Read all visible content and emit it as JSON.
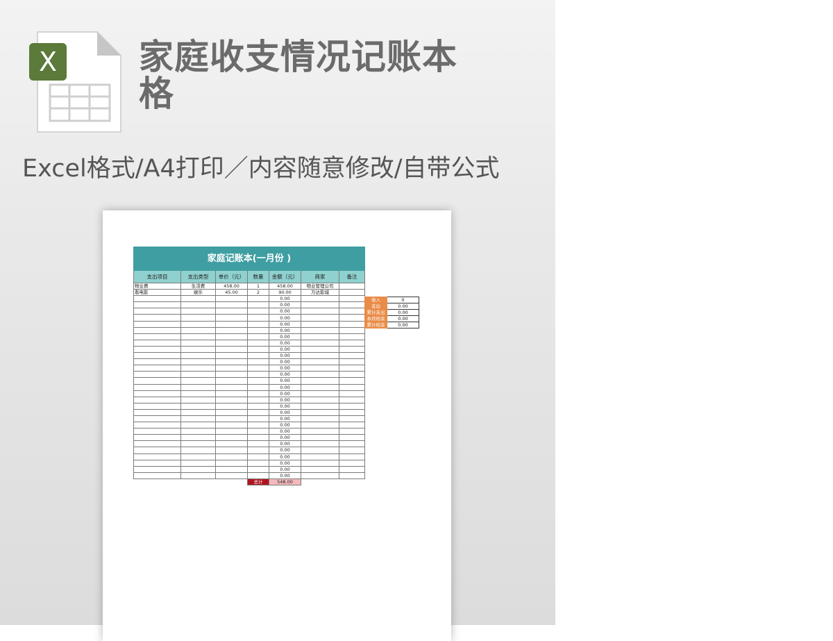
{
  "header": {
    "title": "家庭收支情况记账本格",
    "subtitle": "Excel格式/A4打印／内容随意修改/自带公式"
  },
  "icon": {
    "name": "excel-file-icon",
    "badge_glyph": "X",
    "badge_color": "#5c7a3a",
    "body_color": "#ffffff",
    "fold_color": "#c6c6c6"
  },
  "ledger": {
    "title": "家庭记账本(一月份 )",
    "columns": [
      "支出项目",
      "支出类型",
      "单价（元）",
      "数量",
      "金额（元）",
      "商家",
      "备注"
    ],
    "rows": [
      [
        "物业费",
        "生活费",
        "458.00",
        "1",
        "458.00",
        "物业管理公司",
        ""
      ],
      [
        "看电影",
        "娱乐",
        "45.00",
        "2",
        "90.00",
        "万达影城",
        ""
      ],
      [
        "",
        "",
        "",
        "",
        "0.00",
        "",
        ""
      ],
      [
        "",
        "",
        "",
        "",
        "0.00",
        "",
        ""
      ],
      [
        "",
        "",
        "",
        "",
        "0.00",
        "",
        ""
      ],
      [
        "",
        "",
        "",
        "",
        "0.00",
        "",
        ""
      ],
      [
        "",
        "",
        "",
        "",
        "0.00",
        "",
        ""
      ],
      [
        "",
        "",
        "",
        "",
        "0.00",
        "",
        ""
      ],
      [
        "",
        "",
        "",
        "",
        "0.00",
        "",
        ""
      ],
      [
        "",
        "",
        "",
        "",
        "0.00",
        "",
        ""
      ],
      [
        "",
        "",
        "",
        "",
        "0.00",
        "",
        ""
      ],
      [
        "",
        "",
        "",
        "",
        "0.00",
        "",
        ""
      ],
      [
        "",
        "",
        "",
        "",
        "0.00",
        "",
        ""
      ],
      [
        "",
        "",
        "",
        "",
        "0.00",
        "",
        ""
      ],
      [
        "",
        "",
        "",
        "",
        "0.00",
        "",
        ""
      ],
      [
        "",
        "",
        "",
        "",
        "0.00",
        "",
        ""
      ],
      [
        "",
        "",
        "",
        "",
        "0.00",
        "",
        ""
      ],
      [
        "",
        "",
        "",
        "",
        "0.00",
        "",
        ""
      ],
      [
        "",
        "",
        "",
        "",
        "0.00",
        "",
        ""
      ],
      [
        "",
        "",
        "",
        "",
        "0.00",
        "",
        ""
      ],
      [
        "",
        "",
        "",
        "",
        "0.00",
        "",
        ""
      ],
      [
        "",
        "",
        "",
        "",
        "0.00",
        "",
        ""
      ],
      [
        "",
        "",
        "",
        "",
        "0.00",
        "",
        ""
      ],
      [
        "",
        "",
        "",
        "",
        "0.00",
        "",
        ""
      ],
      [
        "",
        "",
        "",
        "",
        "0.00",
        "",
        ""
      ],
      [
        "",
        "",
        "",
        "",
        "0.00",
        "",
        ""
      ],
      [
        "",
        "",
        "",
        "",
        "0.00",
        "",
        ""
      ],
      [
        "",
        "",
        "",
        "",
        "0.00",
        "",
        ""
      ],
      [
        "",
        "",
        "",
        "",
        "0.00",
        "",
        ""
      ],
      [
        "",
        "",
        "",
        "",
        "0.00",
        "",
        ""
      ],
      [
        "",
        "",
        "",
        "",
        "0.00",
        "",
        ""
      ]
    ],
    "total_label": "总计",
    "total_value": "548.00",
    "colors": {
      "title_bg": "#3f9ea1",
      "header_bg": "#8fd1cf",
      "total_label_bg": "#b0151f",
      "total_value_bg": "#f4b9bd"
    }
  },
  "summary": {
    "label_color": "#e98c47",
    "rows": [
      {
        "label": "收入",
        "value": "0"
      },
      {
        "label": "支出",
        "value": "0.00"
      },
      {
        "label": "累计支出",
        "value": "0.00"
      },
      {
        "label": "本月结余",
        "value": "0.00"
      },
      {
        "label": "累计结余",
        "value": "0.00"
      }
    ]
  }
}
